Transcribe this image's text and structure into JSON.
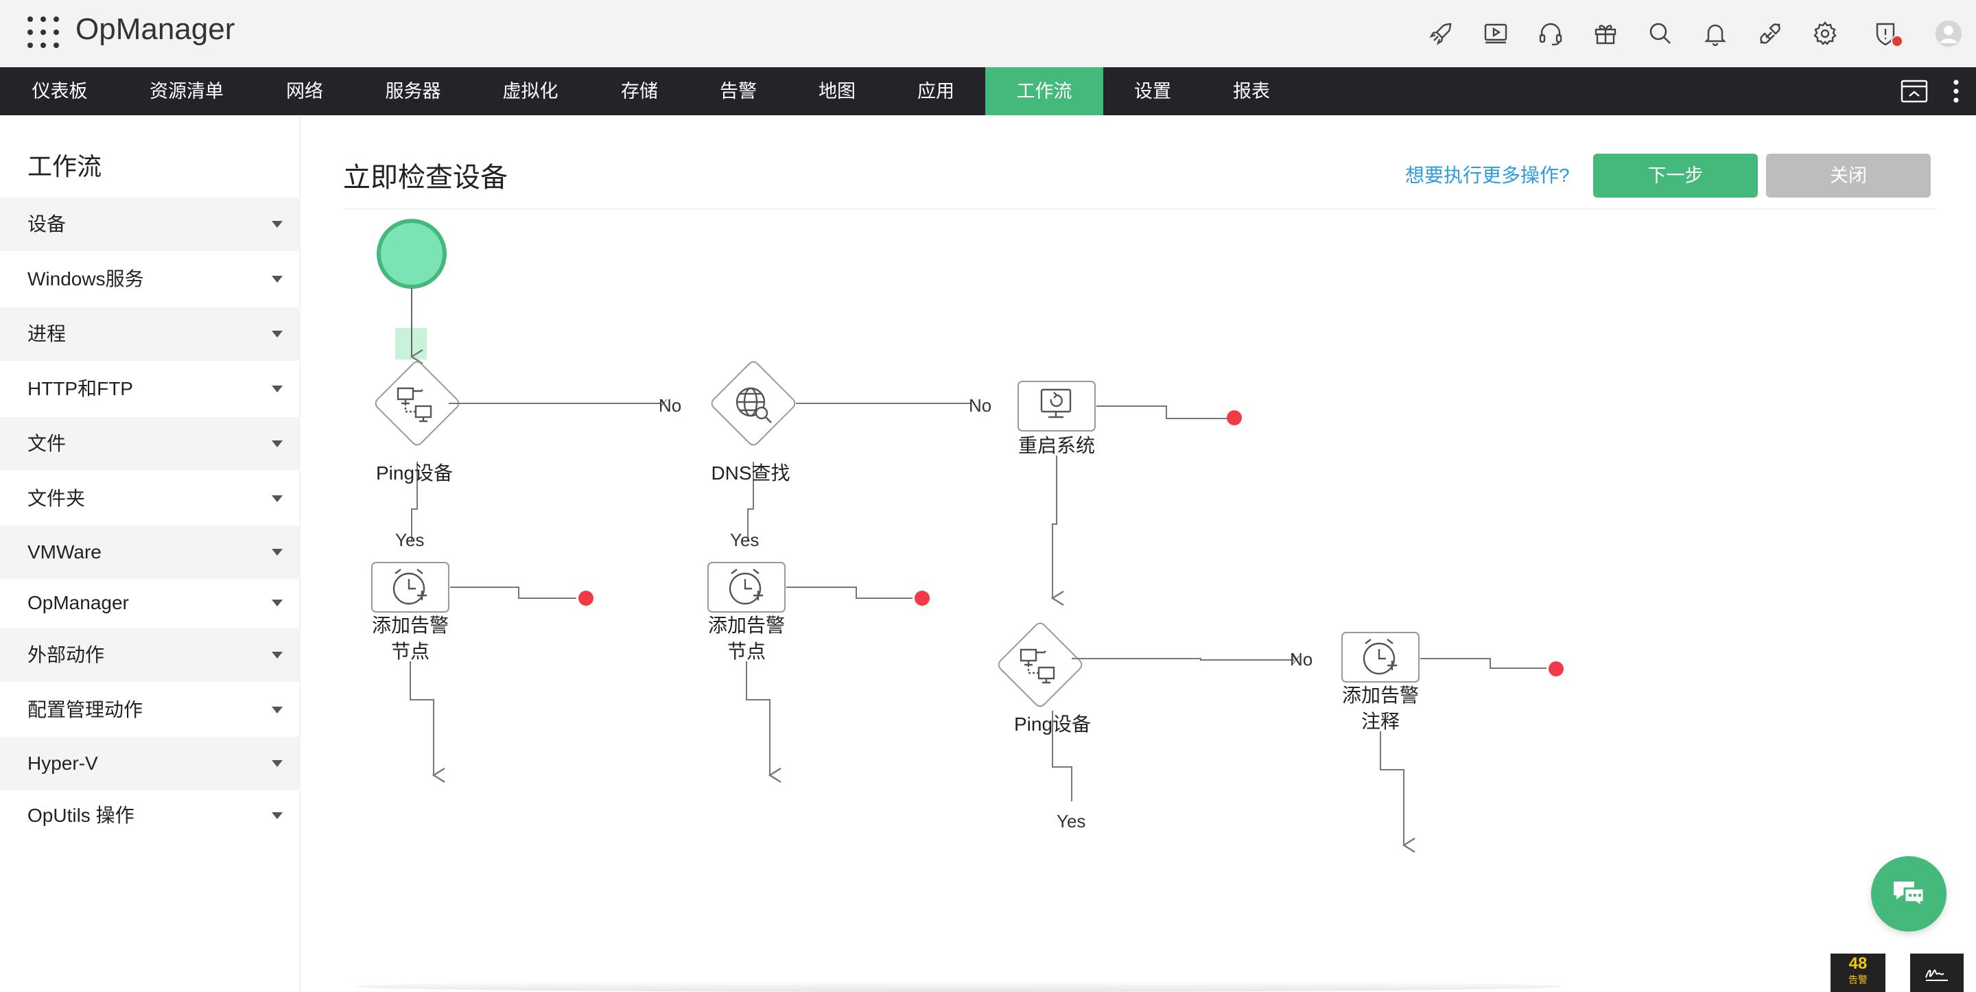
{
  "app": {
    "name": "OpManager"
  },
  "header_icons": [
    "rocket-icon",
    "video-icon",
    "headset-icon",
    "gift-icon",
    "search-icon",
    "bell-icon",
    "plug-icon",
    "gear-icon",
    "shield-alert-icon",
    "user-avatar-icon"
  ],
  "nav": {
    "items": [
      "仪表板",
      "资源清单",
      "网络",
      "服务器",
      "虚拟化",
      "存储",
      "告警",
      "地图",
      "应用",
      "工作流",
      "设置",
      "报表"
    ],
    "active": "工作流"
  },
  "sidebar": {
    "title": "工作流",
    "items": [
      "设备",
      "Windows服务",
      "进程",
      "HTTP和FTP",
      "文件",
      "文件夹",
      "VMWare",
      "OpManager",
      "外部动作",
      "配置管理动作",
      "Hyper-V",
      "OpUtils 操作"
    ]
  },
  "main": {
    "title": "立即检查设备",
    "more_link": "想要执行更多操作?",
    "next_button": "下一步",
    "close_button": "关闭"
  },
  "workflow": {
    "nodes": {
      "ping1": "Ping设备",
      "dns": "DNS查找",
      "reboot": "重启系统",
      "alarm1_line1": "添加告警",
      "alarm1_line2": "节点",
      "alarm2_line1": "添加告警",
      "alarm2_line2": "节点",
      "ping2": "Ping设备",
      "alarm3_line1": "添加告警",
      "alarm3_line2": "注释"
    },
    "edge_labels": {
      "no": "No",
      "yes": "Yes"
    }
  },
  "footer": {
    "alarm_count": "48",
    "alarm_label": "告警"
  },
  "colors": {
    "accent": "#45b97c",
    "nav_bg": "#222427",
    "end_dot": "#f03a47",
    "link": "#2a9ce0"
  }
}
